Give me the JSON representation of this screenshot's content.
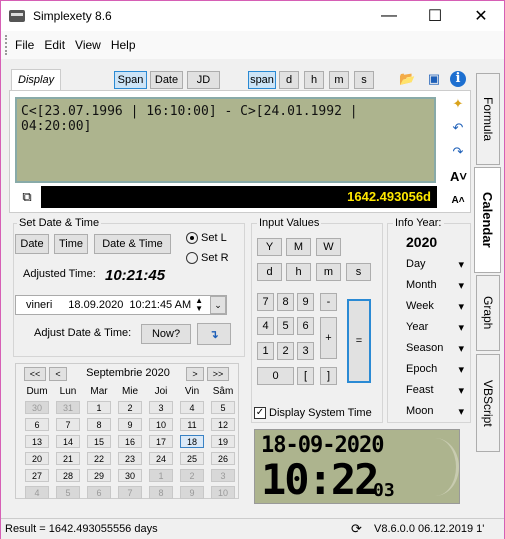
{
  "window": {
    "title": "Simplexety 8.6"
  },
  "menu": [
    "File",
    "Edit",
    "View",
    "Help"
  ],
  "display": {
    "tab": "Display",
    "modes": [
      "Span",
      "Date",
      "JD"
    ],
    "units": [
      "span",
      "d",
      "h",
      "m",
      "s"
    ],
    "text": "C<[23.07.1996 | 16:10:00] - C>[24.01.1992 | 04:20:00]",
    "result": "1642.493056d"
  },
  "setdt": {
    "title": "Set Date & Time",
    "buttons": [
      "Date",
      "Time",
      "Date & Time"
    ],
    "radio_l": "Set L",
    "radio_r": "Set R",
    "adjusted_label": "Adjusted Time:",
    "adjusted_value": "10:21:45",
    "day": "vineri",
    "date": "18.09.2020",
    "time": "10:21:45 AM",
    "adjust_label": "Adjust Date & Time:",
    "now": "Now?"
  },
  "calendar": {
    "month": "Septembrie 2020",
    "days": [
      "Dum",
      "Lun",
      "Mar",
      "Mie",
      "Joi",
      "Vin",
      "Sâm"
    ],
    "cells": [
      "30",
      "31",
      "1",
      "2",
      "3",
      "4",
      "5",
      "6",
      "7",
      "8",
      "9",
      "10",
      "11",
      "12",
      "13",
      "14",
      "15",
      "16",
      "17",
      "18",
      "19",
      "20",
      "21",
      "22",
      "23",
      "24",
      "25",
      "26",
      "27",
      "28",
      "29",
      "30",
      "1",
      "2",
      "3",
      "4",
      "5",
      "6",
      "7",
      "8",
      "9",
      "10"
    ]
  },
  "input": {
    "title": "Input Values",
    "row1": [
      "Y",
      "M",
      "W"
    ],
    "row2": [
      "d",
      "h",
      "m",
      "s"
    ],
    "keys": [
      "7",
      "8",
      "9",
      "-",
      "4",
      "5",
      "6",
      "+",
      "1",
      "2",
      "3",
      "=",
      "0",
      "[",
      "]"
    ],
    "system_time": "Display System Time"
  },
  "info": {
    "title": "Info Year:",
    "year": "2020",
    "items": [
      "Day",
      "Month",
      "Week",
      "Year",
      "Season",
      "Epoch",
      "Feast",
      "Moon"
    ]
  },
  "clock": {
    "date": "18-09-2020",
    "time": "10:22",
    "sec": "03"
  },
  "tabs": [
    "Formula",
    "Calendar",
    "Graph",
    "VBScript"
  ],
  "status": {
    "result": "Result = 1642.493055556 days",
    "version": "V8.6.0.0  06.12.2019 1'"
  }
}
